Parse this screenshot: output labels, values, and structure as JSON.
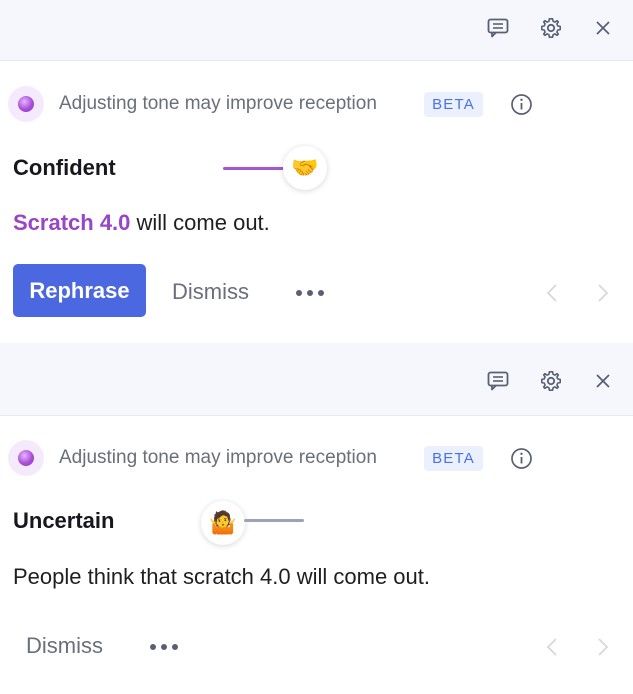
{
  "cards": [
    {
      "header_text": "Adjusting tone may improve reception",
      "badge": "BETA",
      "tone": "Confident",
      "tone_emoji": "🤝",
      "sentence_highlight": "Scratch 4.0",
      "sentence_rest": " will come out.",
      "primary_button": "Rephrase",
      "dismiss_button": "Dismiss"
    },
    {
      "header_text": "Adjusting tone may improve reception",
      "badge": "BETA",
      "tone": "Uncertain",
      "tone_emoji": "🤷",
      "sentence": "People think that scratch 4.0 will come out.",
      "dismiss_button": "Dismiss"
    }
  ],
  "icons": {
    "feedback": "feedback-icon",
    "settings": "gear-icon",
    "close": "close-icon",
    "info": "info-icon",
    "more": "more-options-icon",
    "prev": "chevron-left-icon",
    "next": "chevron-right-icon"
  },
  "colors": {
    "primary": "#4b68e0",
    "highlight": "#9a44c8",
    "badge_bg": "#eaf0fd",
    "badge_text": "#4a73e0",
    "topbar_bg": "#f6f7fd"
  }
}
